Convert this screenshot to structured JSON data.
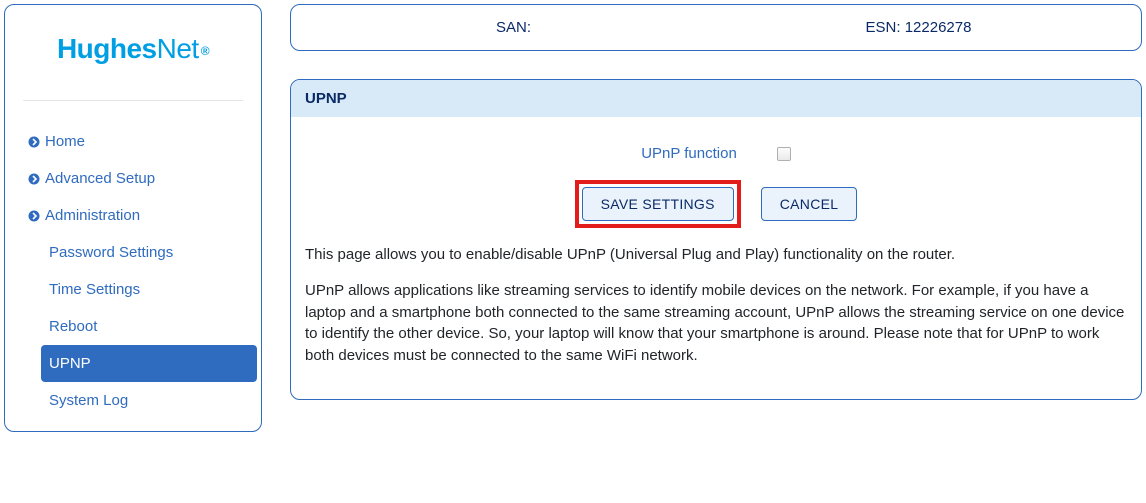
{
  "brand": {
    "primary": "Hughes",
    "secondary": "Net"
  },
  "nav": {
    "home": "Home",
    "advanced": "Advanced Setup",
    "admin": "Administration",
    "admin_items": {
      "password": "Password Settings",
      "time": "Time Settings",
      "reboot": "Reboot",
      "upnp": "UPNP",
      "syslog": "System Log"
    }
  },
  "topbar": {
    "san_label": "SAN:",
    "esn_label": "ESN: 12226278"
  },
  "panel": {
    "title": "UPNP",
    "field_label": "UPnP function",
    "save": "SAVE SETTINGS",
    "cancel": "CANCEL",
    "para1": "This page allows you to enable/disable UPnP (Universal Plug and Play) functionality on the router.",
    "para2": "UPnP allows applications like streaming services to identify mobile devices on the network. For example, if you have a laptop and a smartphone both connected to the same streaming account, UPnP allows the streaming service on one device to identify the other device. So, your laptop will know that your smartphone is around. Please note that for UPnP to work both devices must be connected to the same WiFi network."
  }
}
